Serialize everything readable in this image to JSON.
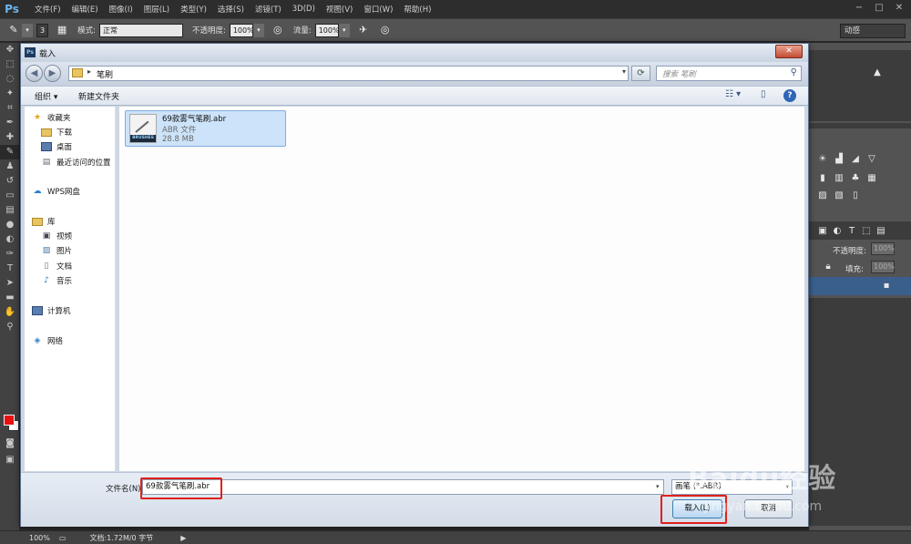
{
  "app": {
    "logo": "Ps"
  },
  "menu": [
    "文件(F)",
    "编辑(E)",
    "图像(I)",
    "图层(L)",
    "类型(Y)",
    "选择(S)",
    "滤镜(T)",
    "3D(D)",
    "视图(V)",
    "窗口(W)",
    "帮助(H)"
  ],
  "options": {
    "brush_size": "3",
    "mode_label": "模式:",
    "mode_value": "正常",
    "opacity_label": "不透明度:",
    "opacity_value": "100%",
    "flow_label": "流量:",
    "flow_value": "100%",
    "workspace": "动感"
  },
  "right_panel": {
    "layer_opacity_label": "不透明度:",
    "layer_opacity_value": "100%",
    "fill_label": "填充:",
    "fill_value": "100%"
  },
  "status": {
    "zoom": "100%",
    "doc": "文档:1.72M/0 字节"
  },
  "dialog": {
    "title": "载入",
    "close": "✕",
    "breadcrumb": "笔刷",
    "search_placeholder": "搜索 笔刷",
    "organize": "组织 ▾",
    "new_folder": "新建文件夹",
    "nav": {
      "favorites": "收藏夹",
      "downloads": "下载",
      "desktop": "桌面",
      "recent": "最近访问的位置",
      "wps": "WPS网盘",
      "library": "库",
      "videos": "视频",
      "pictures": "图片",
      "documents": "文档",
      "music": "音乐",
      "computer": "计算机",
      "network": "网络"
    },
    "file": {
      "name": "69款雾气笔刷.abr",
      "type": "ABR 文件",
      "size": "28.8 MB",
      "thumb_label": "BRUSHES"
    },
    "filename_label": "文件名(N):",
    "filename_value": "69款雾气笔刷.abr",
    "filetype_value": "画笔 (*.ABR)",
    "load_button": "载入(L)",
    "cancel_button": "取消"
  },
  "watermark": {
    "main": "Baidu经验",
    "sub": "jingyan.baidu.com"
  },
  "colors": {
    "foreground": "#e8110f",
    "highlight": "#e0201a"
  }
}
